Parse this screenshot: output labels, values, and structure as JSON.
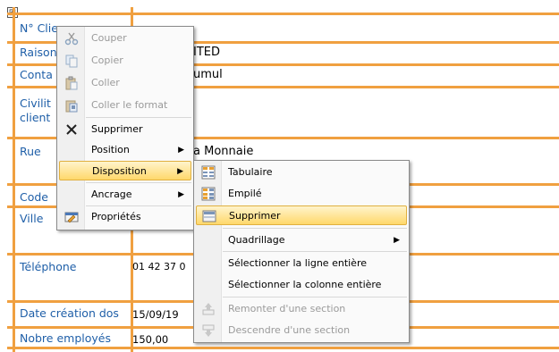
{
  "form": {
    "selector_glyph": "⊞",
    "rows": [
      {
        "label": "N° Clie",
        "value": ""
      },
      {
        "label": "Raison",
        "value": "ITED"
      },
      {
        "label": "Conta",
        "value": "umul"
      },
      {
        "label": "Civilit",
        "value": ""
      },
      {
        "label": "client",
        "value": ""
      },
      {
        "label": "Rue",
        "value": "a Monnaie"
      },
      {
        "label": "Code",
        "value": ""
      },
      {
        "label": "Ville",
        "value": ""
      },
      {
        "label": "Téléphone",
        "value": "01 42 37 0"
      },
      {
        "label": "Date création dos",
        "value": "15/09/19"
      },
      {
        "label": "Nobre employés",
        "value": "150,00"
      }
    ]
  },
  "context_menu": {
    "items": [
      {
        "label": "Couper",
        "icon": "scissors-icon",
        "disabled": true
      },
      {
        "label": "Copier",
        "icon": "copy-icon",
        "disabled": true
      },
      {
        "label": "Coller",
        "icon": "paste-icon",
        "disabled": true
      },
      {
        "label": "Coller le format",
        "icon": "paste-format-icon",
        "disabled": true
      },
      {
        "label": "Supprimer",
        "icon": "delete-x-icon",
        "disabled": false
      },
      {
        "label": "Position",
        "icon": "",
        "disabled": false,
        "submenu": true
      },
      {
        "label": "Disposition",
        "icon": "",
        "disabled": false,
        "submenu": true,
        "active": true
      },
      {
        "label": "Ancrage",
        "icon": "",
        "disabled": false,
        "submenu": true
      },
      {
        "label": "Propriétés",
        "icon": "properties-icon",
        "disabled": false
      }
    ]
  },
  "submenu": {
    "items": [
      {
        "label": "Tabulaire",
        "icon": "tabular-layout-icon",
        "disabled": false
      },
      {
        "label": "Empilé",
        "icon": "stacked-layout-icon",
        "disabled": false
      },
      {
        "label": "Supprimer",
        "icon": "remove-layout-icon",
        "disabled": false,
        "active": true
      },
      {
        "label": "Quadrillage",
        "icon": "",
        "disabled": false,
        "submenu": true
      },
      {
        "label": "Sélectionner la ligne entière",
        "icon": "",
        "disabled": false
      },
      {
        "label": "Sélectionner la colonne entière",
        "icon": "",
        "disabled": false
      },
      {
        "label": "Remonter d'une section",
        "icon": "move-up-icon",
        "disabled": true
      },
      {
        "label": "Descendre d'une section",
        "icon": "move-down-icon",
        "disabled": true
      }
    ]
  },
  "colors": {
    "grid_line": "#f0a040",
    "label_text": "#1f5fa8",
    "highlight_top": "#fff4cc",
    "highlight_bottom": "#ffd86b"
  }
}
